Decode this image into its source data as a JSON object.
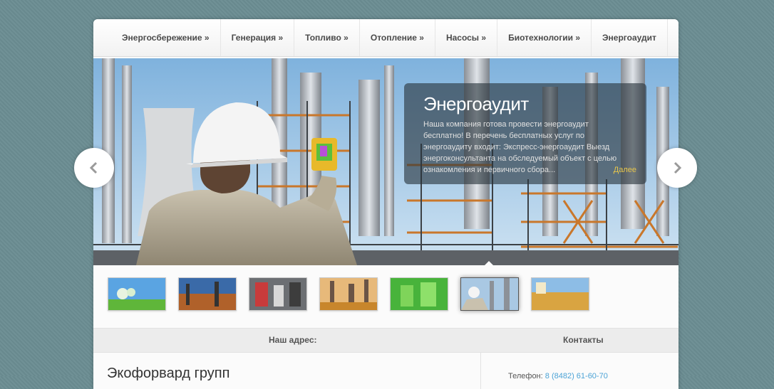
{
  "nav": {
    "items": [
      {
        "label": "Энергосбережение »"
      },
      {
        "label": "Генерация »"
      },
      {
        "label": "Топливо »"
      },
      {
        "label": "Отопление »"
      },
      {
        "label": "Насосы »"
      },
      {
        "label": "Биотехнологии »"
      },
      {
        "label": "Энергоаудит"
      }
    ]
  },
  "slider": {
    "title": "Энергоаудит",
    "text": "Наша компания готова провести энергоаудит бесплатно! В перечень бесплатных услуг по энергоаудиту входит: Экспресс-энергоаудит Выезд энергоконсультанта на обследуемый объект с целью ознакомления и   первичного сбора...",
    "more_label": "Далее",
    "prev_icon": "chevron-left-icon",
    "next_icon": "chevron-right-icon",
    "active_thumb": 6
  },
  "thumbnails": [
    {
      "name": "eco-sprout"
    },
    {
      "name": "refinery-sunset"
    },
    {
      "name": "heating-pipes"
    },
    {
      "name": "plant-towers"
    },
    {
      "name": "green-liquid"
    },
    {
      "name": "energy-audit"
    },
    {
      "name": "wheat-field"
    }
  ],
  "footer": {
    "address_heading": "Наш адрес:",
    "contacts_heading": "Контакты",
    "company_name": "Экофорвард групп",
    "phone_label": "Телефон:",
    "phone_value": "8 (8482) 61-60-70"
  },
  "colors": {
    "background": "#6b8d93",
    "accent_more": "#e8c64b",
    "link": "#4ca3d6"
  }
}
